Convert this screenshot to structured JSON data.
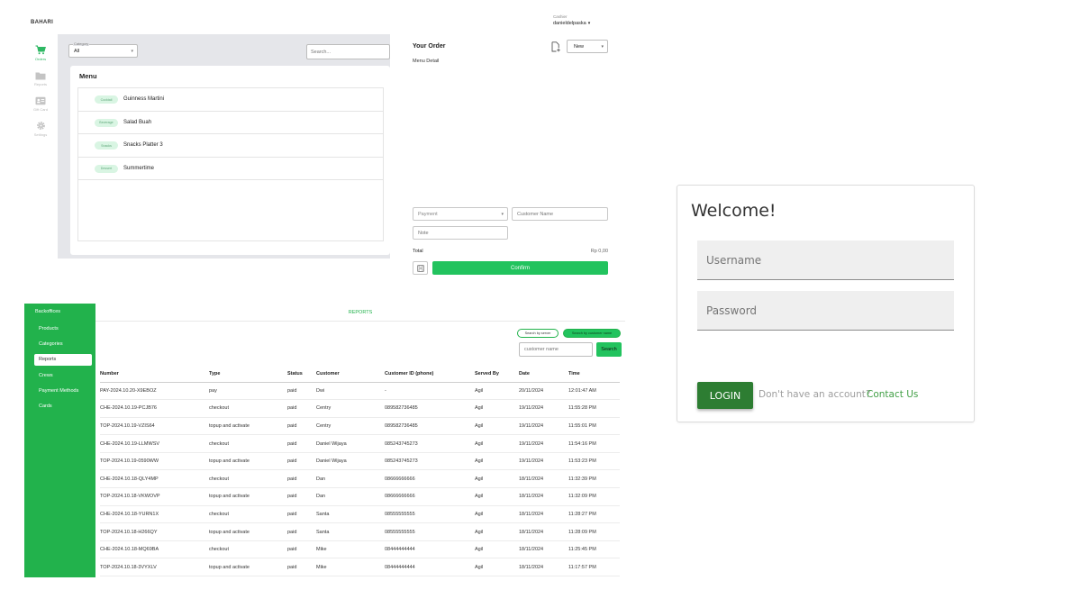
{
  "pos": {
    "brand": "BAHARI",
    "cashier_label": "Cashier",
    "cashier_name": "danieldelpaska",
    "nav": [
      {
        "label": "Orders",
        "icon": "cart-icon"
      },
      {
        "label": "Reports",
        "icon": "folder-icon"
      },
      {
        "label": "Gift Card",
        "icon": "id-card-icon"
      },
      {
        "label": "Settings",
        "icon": "gear-icon"
      }
    ],
    "category_label": "Category",
    "category_value": "All",
    "search_placeholder": "Search...",
    "menu_title": "Menu",
    "menu_items": [
      {
        "badge": "Cocktail",
        "name": "Guinness Martini"
      },
      {
        "badge": "Beverage",
        "name": "Salad Buah"
      },
      {
        "badge": "Snacks",
        "name": "Snacks Platter 3"
      },
      {
        "badge": "Dessert",
        "name": "Summertime"
      }
    ],
    "order_title": "Your Order",
    "menu_detail": "Menu Detail",
    "order_type": "New",
    "payment_placeholder": "Payment",
    "customer_name_placeholder": "Customer Name",
    "note_placeholder": "Note",
    "total_label": "Total",
    "total_value": "Rp 0,00",
    "confirm_label": "Confirm",
    "accent_color": "#22c35e"
  },
  "backoffice": {
    "title": "Backoffices",
    "items": [
      "Products",
      "Categories",
      "Reports",
      "Crews",
      "Payment Methods",
      "Cards"
    ],
    "active_item": "Reports",
    "header": "REPORTS",
    "chip_server": "Search by server",
    "chip_customer": "Search by customer name",
    "search_placeholder": "customer name",
    "search_button": "Search",
    "columns": [
      "Number",
      "Type",
      "Status",
      "Customer",
      "Customer ID (phone)",
      "Served By",
      "Date",
      "Time"
    ],
    "rows": [
      [
        "PAY-2024.10.20-X9EBOZ",
        "pay",
        "paid",
        "Dwi",
        "-",
        "Agil",
        "20/11/2024",
        "12:01:47 AM"
      ],
      [
        "CHE-2024.10.19-PCJB76",
        "checkout",
        "paid",
        "Centry",
        "089582736485",
        "Agil",
        "19/11/2024",
        "11:55:28 PM"
      ],
      [
        "TOP-2024.10.19-VZIS64",
        "topup and activate",
        "paid",
        "Centry",
        "089582736485",
        "Agil",
        "19/11/2024",
        "11:55:01 PM"
      ],
      [
        "CHE-2024.10.19-LLMWSV",
        "checkout",
        "paid",
        "Daniel Wijaya",
        "085243745273",
        "Agil",
        "19/11/2024",
        "11:54:16 PM"
      ],
      [
        "TOP-2024.10.19-0590WW",
        "topup and activate",
        "paid",
        "Daniel Wijaya",
        "085243745273",
        "Agil",
        "19/11/2024",
        "11:53:23 PM"
      ],
      [
        "CHE-2024.10.18-QLY4MP",
        "checkout",
        "paid",
        "Dan",
        "08666666666",
        "Agil",
        "18/11/2024",
        "11:32:39 PM"
      ],
      [
        "TOP-2024.10.18-VKWOVP",
        "topup and activate",
        "paid",
        "Dan",
        "08666666666",
        "Agil",
        "18/11/2024",
        "11:32:09 PM"
      ],
      [
        "CHE-2024.10.18-YURN1X",
        "checkout",
        "paid",
        "Santa",
        "08555555555",
        "Agil",
        "18/11/2024",
        "11:28:27 PM"
      ],
      [
        "TOP-2024.10.18-H266QY",
        "topup and activate",
        "paid",
        "Santa",
        "08555555555",
        "Agil",
        "18/11/2024",
        "11:28:09 PM"
      ],
      [
        "CHE-2024.10.18-MQ69BA",
        "checkout",
        "paid",
        "Mike",
        "08444444444",
        "Agil",
        "18/11/2024",
        "11:25:45 PM"
      ],
      [
        "TOP-2024.10.18-3VYXLV",
        "topup and activate",
        "paid",
        "Mike",
        "08444444444",
        "Agil",
        "18/11/2024",
        "11:17:57 PM"
      ]
    ],
    "accent_color": "#22b24c"
  },
  "login": {
    "title": "Welcome!",
    "username_placeholder": "Username",
    "password_placeholder": "Password",
    "login_button": "LOGIN",
    "no_account_text": "Don't have an account?",
    "contact_link": "Contact Us",
    "button_color": "#2d7d32"
  }
}
